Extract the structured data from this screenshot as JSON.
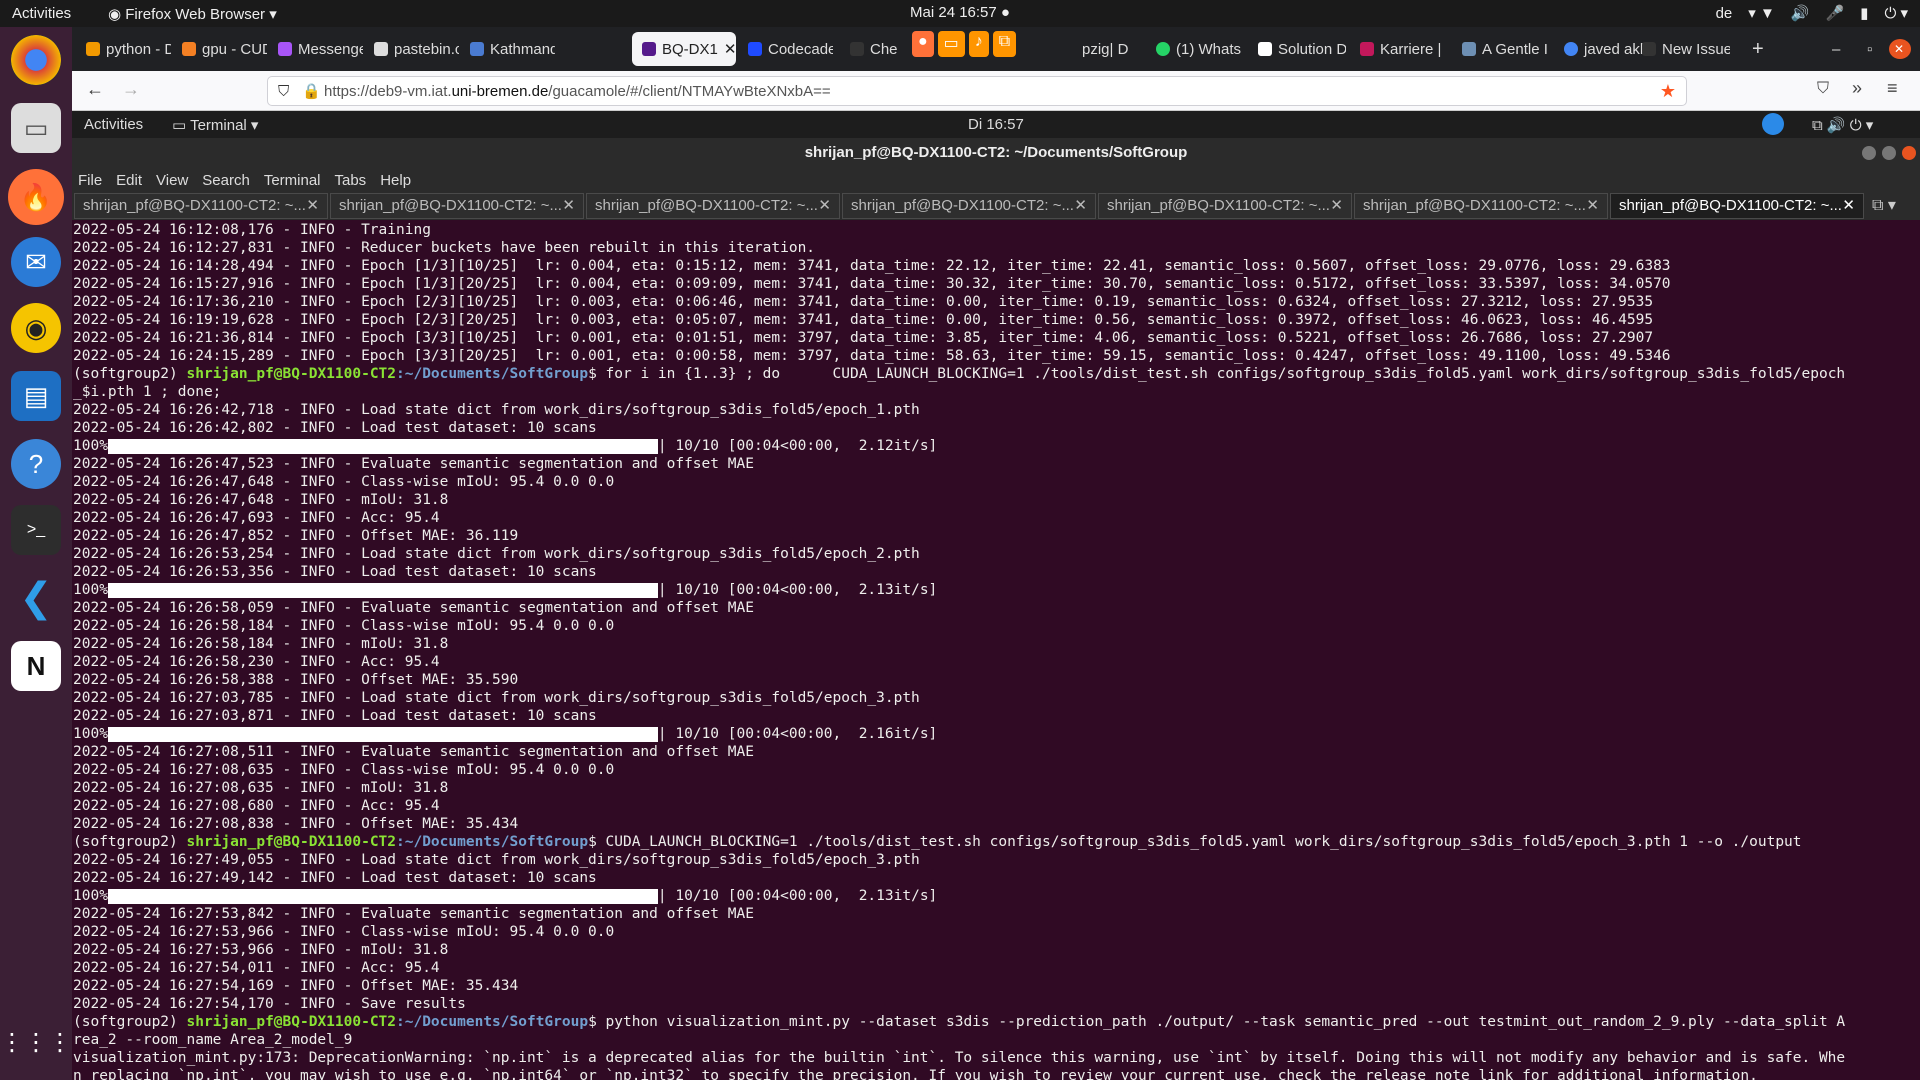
{
  "topbar": {
    "activities": "Activities",
    "app": "Firefox Web Browser",
    "clock": "Mai 24  16:57",
    "lang": "de"
  },
  "firefox": {
    "tabs": [
      {
        "label": "python - D",
        "color": "#f29900"
      },
      {
        "label": "gpu - CUD",
        "color": "#f48024"
      },
      {
        "label": "Messenge",
        "color": "#a855f7"
      },
      {
        "label": "pastebin.c",
        "color": "#dddddd"
      },
      {
        "label": "Kathmand",
        "color": "#4a7bd1"
      },
      {
        "label": "BQ-DX1",
        "color": "#551a8b"
      },
      {
        "label": "Codecade",
        "color": "#1f4bff"
      },
      {
        "label": "Che",
        "color": "#333"
      },
      {
        "label": "pzig| D",
        "color": "#888"
      },
      {
        "label": "(1) Whats",
        "color": "#25d366"
      },
      {
        "label": "Solution D",
        "color": "#ffffff"
      },
      {
        "label": "Karriere |",
        "color": "#c2185b"
      },
      {
        "label": "A Gentle I",
        "color": "#6d8fb3"
      },
      {
        "label": "javed akh",
        "color": "#4285f4"
      },
      {
        "label": "New Issue",
        "color": "#333"
      }
    ],
    "url_pre": "https://deb9-vm.iat.",
    "url_host": "uni-bremen.de",
    "url_post": "/guacamole/#/client/NTMAYwBteXNxbA=="
  },
  "remote": {
    "activities": "Activities",
    "app": "Terminal",
    "clock": "Di 16:57"
  },
  "window_title": "shrijan_pf@BQ-DX1100-CT2: ~/Documents/SoftGroup",
  "menu": [
    "File",
    "Edit",
    "View",
    "Search",
    "Terminal",
    "Tabs",
    "Help"
  ],
  "term_tab_label": "shrijan_pf@BQ-DX1100-CT2: ~...",
  "terminal": {
    "prompt_env": "(softgroup2) ",
    "prompt_user": "shrijan_pf@BQ-DX1100-CT2",
    "prompt_path": ":~/Documents/SoftGroup",
    "cmd1": "$ for i in {1..3} ; do      CUDA_LAUNCH_BLOCKING=1 ./tools/dist_test.sh configs/softgroup_s3dis_fold5.yaml work_dirs/softgroup_s3dis_fold5/epoch",
    "cmd1b": "_$i.pth 1 ; done;",
    "cmd2": "$ CUDA_LAUNCH_BLOCKING=1 ./tools/dist_test.sh configs/softgroup_s3dis_fold5.yaml work_dirs/softgroup_s3dis_fold5/epoch_3.pth 1 --o ./output",
    "cmd3": "$ python visualization_mint.py --dataset s3dis --prediction_path ./output/ --task semantic_pred --out testmint_out_random_2_9.ply --data_split A",
    "cmd3b": "rea_2 --room_name Area_2_model_9",
    "lines_a": [
      "2022-05-24 16:12:08,176 - INFO - Training",
      "2022-05-24 16:12:27,831 - INFO - Reducer buckets have been rebuilt in this iteration.",
      "2022-05-24 16:14:28,494 - INFO - Epoch [1/3][10/25]  lr: 0.004, eta: 0:15:12, mem: 3741, data_time: 22.12, iter_time: 22.41, semantic_loss: 0.5607, offset_loss: 29.0776, loss: 29.6383",
      "2022-05-24 16:15:27,916 - INFO - Epoch [1/3][20/25]  lr: 0.004, eta: 0:09:09, mem: 3741, data_time: 30.32, iter_time: 30.70, semantic_loss: 0.5172, offset_loss: 33.5397, loss: 34.0570",
      "2022-05-24 16:17:36,210 - INFO - Epoch [2/3][10/25]  lr: 0.003, eta: 0:06:46, mem: 3741, data_time: 0.00, iter_time: 0.19, semantic_loss: 0.6324, offset_loss: 27.3212, loss: 27.9535",
      "2022-05-24 16:19:19,628 - INFO - Epoch [2/3][20/25]  lr: 0.003, eta: 0:05:07, mem: 3741, data_time: 0.00, iter_time: 0.56, semantic_loss: 0.3972, offset_loss: 46.0623, loss: 46.4595",
      "2022-05-24 16:21:36,814 - INFO - Epoch [3/3][10/25]  lr: 0.001, eta: 0:01:51, mem: 3797, data_time: 3.85, iter_time: 4.06, semantic_loss: 0.5221, offset_loss: 26.7686, loss: 27.2907",
      "2022-05-24 16:24:15,289 - INFO - Epoch [3/3][20/25]  lr: 0.001, eta: 0:00:58, mem: 3797, data_time: 58.63, iter_time: 59.15, semantic_loss: 0.4247, offset_loss: 49.1100, loss: 49.5346"
    ],
    "block1_pre": [
      "2022-05-24 16:26:42,718 - INFO - Load state dict from work_dirs/softgroup_s3dis_fold5/epoch_1.pth",
      "2022-05-24 16:26:42,802 - INFO - Load test dataset: 10 scans"
    ],
    "bar1": "| 10/10 [00:04<00:00,  2.12it/s]",
    "block1_post": [
      "2022-05-24 16:26:47,523 - INFO - Evaluate semantic segmentation and offset MAE",
      "2022-05-24 16:26:47,648 - INFO - Class-wise mIoU: 95.4 0.0 0.0",
      "2022-05-24 16:26:47,648 - INFO - mIoU: 31.8",
      "2022-05-24 16:26:47,693 - INFO - Acc: 95.4",
      "2022-05-24 16:26:47,852 - INFO - Offset MAE: 36.119",
      "2022-05-24 16:26:53,254 - INFO - Load state dict from work_dirs/softgroup_s3dis_fold5/epoch_2.pth",
      "2022-05-24 16:26:53,356 - INFO - Load test dataset: 10 scans"
    ],
    "bar2": "| 10/10 [00:04<00:00,  2.13it/s]",
    "block2_post": [
      "2022-05-24 16:26:58,059 - INFO - Evaluate semantic segmentation and offset MAE",
      "2022-05-24 16:26:58,184 - INFO - Class-wise mIoU: 95.4 0.0 0.0",
      "2022-05-24 16:26:58,184 - INFO - mIoU: 31.8",
      "2022-05-24 16:26:58,230 - INFO - Acc: 95.4",
      "2022-05-24 16:26:58,388 - INFO - Offset MAE: 35.590",
      "2022-05-24 16:27:03,785 - INFO - Load state dict from work_dirs/softgroup_s3dis_fold5/epoch_3.pth",
      "2022-05-24 16:27:03,871 - INFO - Load test dataset: 10 scans"
    ],
    "bar3": "| 10/10 [00:04<00:00,  2.16it/s]",
    "block3_post": [
      "2022-05-24 16:27:08,511 - INFO - Evaluate semantic segmentation and offset MAE",
      "2022-05-24 16:27:08,635 - INFO - Class-wise mIoU: 95.4 0.0 0.0",
      "2022-05-24 16:27:08,635 - INFO - mIoU: 31.8",
      "2022-05-24 16:27:08,680 - INFO - Acc: 95.4",
      "2022-05-24 16:27:08,838 - INFO - Offset MAE: 35.434"
    ],
    "block4_pre": [
      "2022-05-24 16:27:49,055 - INFO - Load state dict from work_dirs/softgroup_s3dis_fold5/epoch_3.pth",
      "2022-05-24 16:27:49,142 - INFO - Load test dataset: 10 scans"
    ],
    "bar4": "| 10/10 [00:04<00:00,  2.13it/s]",
    "block4_post": [
      "2022-05-24 16:27:53,842 - INFO - Evaluate semantic segmentation and offset MAE",
      "2022-05-24 16:27:53,966 - INFO - Class-wise mIoU: 95.4 0.0 0.0",
      "2022-05-24 16:27:53,966 - INFO - mIoU: 31.8",
      "2022-05-24 16:27:54,011 - INFO - Acc: 95.4",
      "2022-05-24 16:27:54,169 - INFO - Offset MAE: 35.434",
      "2022-05-24 16:27:54,170 - INFO - Save results"
    ],
    "bar_pct": "100%",
    "warn": [
      "visualization_mint.py:173: DeprecationWarning: `np.int` is a deprecated alias for the builtin `int`. To silence this warning, use `int` by itself. Doing this will not modify any behavior and is safe. Whe",
      "n replacing `np.int`, you may wish to use e.g. `np.int64` or `np.int32` to specify the precision. If you wish to review your current use, check the release note link for additional information."
    ]
  }
}
